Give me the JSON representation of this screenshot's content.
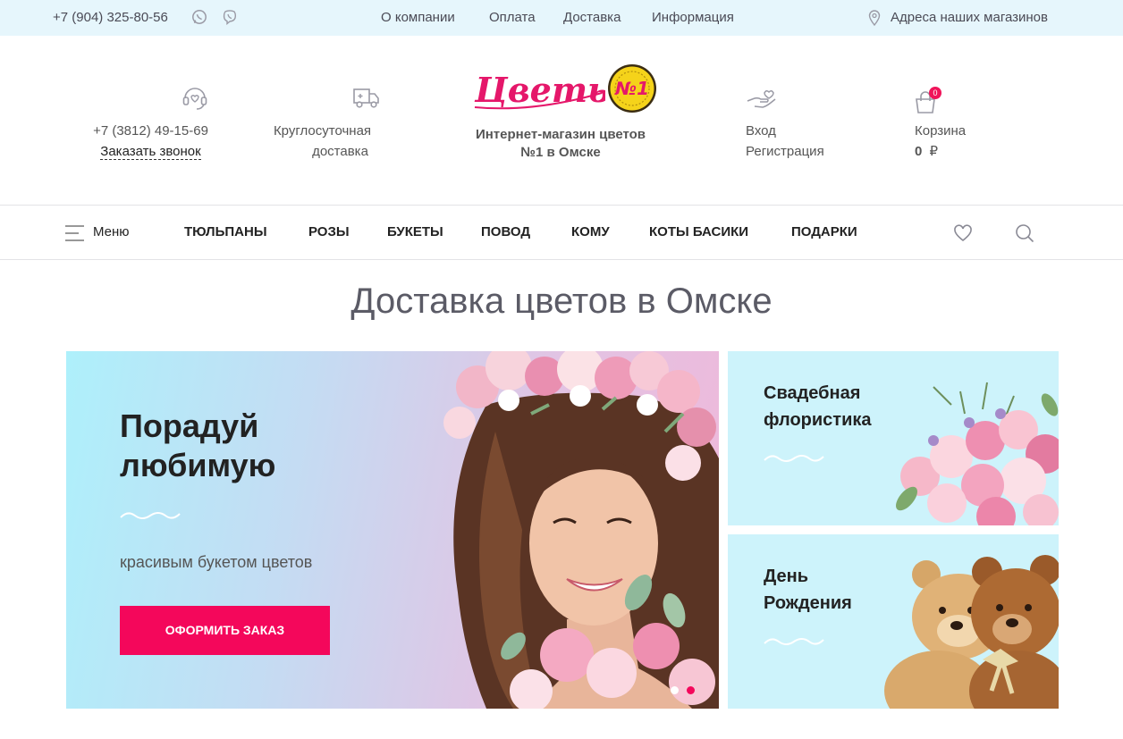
{
  "topbar": {
    "phone": "+7 (904) 325-80-56",
    "icons": [
      "whatsapp-icon",
      "viber-icon"
    ],
    "nav": [
      "О компании",
      "Оплата",
      "Доставка",
      "Информация"
    ],
    "address_link": "Адреса наших магазинов"
  },
  "header": {
    "phone": "+7 (3812) 49-15-69",
    "callback": "Заказать звонок",
    "delivery_line1": "Круглосуточная",
    "delivery_line2": "доставка",
    "logo_word": "Цветы",
    "logo_badge": "№1",
    "caption_line1": "Интернет-магазин цветов",
    "caption_line2": "№1 в Омске",
    "login": "Вход",
    "register": "Регистрация",
    "cart_label": "Корзина",
    "cart_count": "0",
    "cart_sum": "0",
    "currency": "₽"
  },
  "nav": {
    "menu_label": "Меню",
    "items": [
      "ТЮЛЬПАНЫ",
      "РОЗЫ",
      "БУКЕТЫ",
      "ПОВОД",
      "КОМУ",
      "КОТЫ БАСИКИ",
      "ПОДАРКИ"
    ]
  },
  "page_title": "Доставка цветов в Омске",
  "hero": {
    "title_line1": "Порадуй",
    "title_line2": "любимую",
    "subtitle": "красивым букетом цветов",
    "button": "ОФОРМИТЬ ЗАКАЗ",
    "slides": 2,
    "active_slide": 2
  },
  "cards": [
    {
      "line1": "Свадебная",
      "line2": "флористика"
    },
    {
      "line1": "День",
      "line2": "Рождения"
    }
  ],
  "colors": {
    "accent": "#f4075b",
    "topbar_bg": "#e6f6fc",
    "card_bg": "#cdf3fb"
  }
}
